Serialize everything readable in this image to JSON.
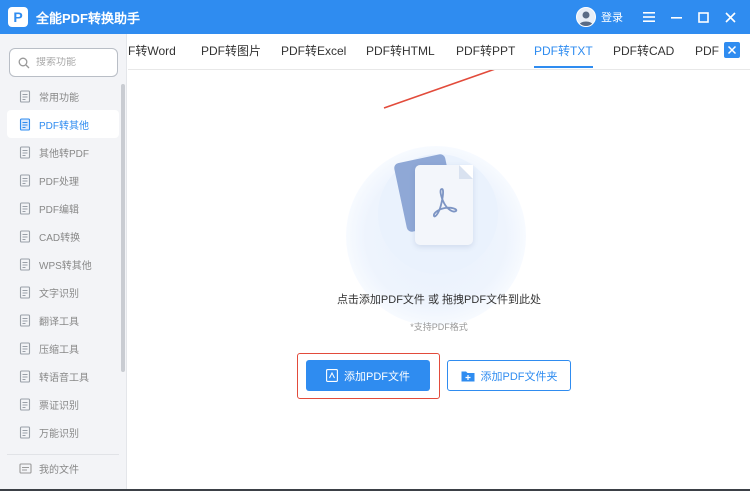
{
  "app": {
    "title": "全能PDF转换助手",
    "logo_letter": "P",
    "login_label": "登录"
  },
  "colors": {
    "accent": "#2f8cf0",
    "annotation_red": "#e24b3b"
  },
  "sidebar": {
    "search_placeholder": "搜索功能",
    "items": [
      {
        "label": "常用功能",
        "icon": "home-grid-icon"
      },
      {
        "label": "PDF转其他",
        "icon": "pdf-export-icon",
        "active": true
      },
      {
        "label": "其他转PDF",
        "icon": "pdf-import-icon"
      },
      {
        "label": "PDF处理",
        "icon": "pdf-process-icon"
      },
      {
        "label": "PDF编辑",
        "icon": "pdf-edit-icon"
      },
      {
        "label": "CAD转换",
        "icon": "cad-icon"
      },
      {
        "label": "WPS转其他",
        "icon": "wps-icon"
      },
      {
        "label": "文字识别",
        "icon": "ocr-icon"
      },
      {
        "label": "翻译工具",
        "icon": "translate-icon"
      },
      {
        "label": "压缩工具",
        "icon": "compress-icon"
      },
      {
        "label": "转语音工具",
        "icon": "speech-icon"
      },
      {
        "label": "票证识别",
        "icon": "ticket-icon"
      },
      {
        "label": "万能识别",
        "icon": "scan-icon"
      }
    ],
    "my_files": "我的文件"
  },
  "tabs": [
    {
      "label": "F转Word"
    },
    {
      "label": "PDF转图片"
    },
    {
      "label": "PDF转Excel"
    },
    {
      "label": "PDF转HTML"
    },
    {
      "label": "PDF转PPT"
    },
    {
      "label": "PDF转TXT",
      "active": true
    },
    {
      "label": "PDF转CAD"
    },
    {
      "label": "PDF"
    }
  ],
  "main": {
    "hint": "点击添加PDF文件 或 拖拽PDF文件到此处",
    "sub_hint": "*支持PDF格式",
    "add_file_label": "添加PDF文件",
    "add_folder_label": "添加PDF文件夹"
  }
}
